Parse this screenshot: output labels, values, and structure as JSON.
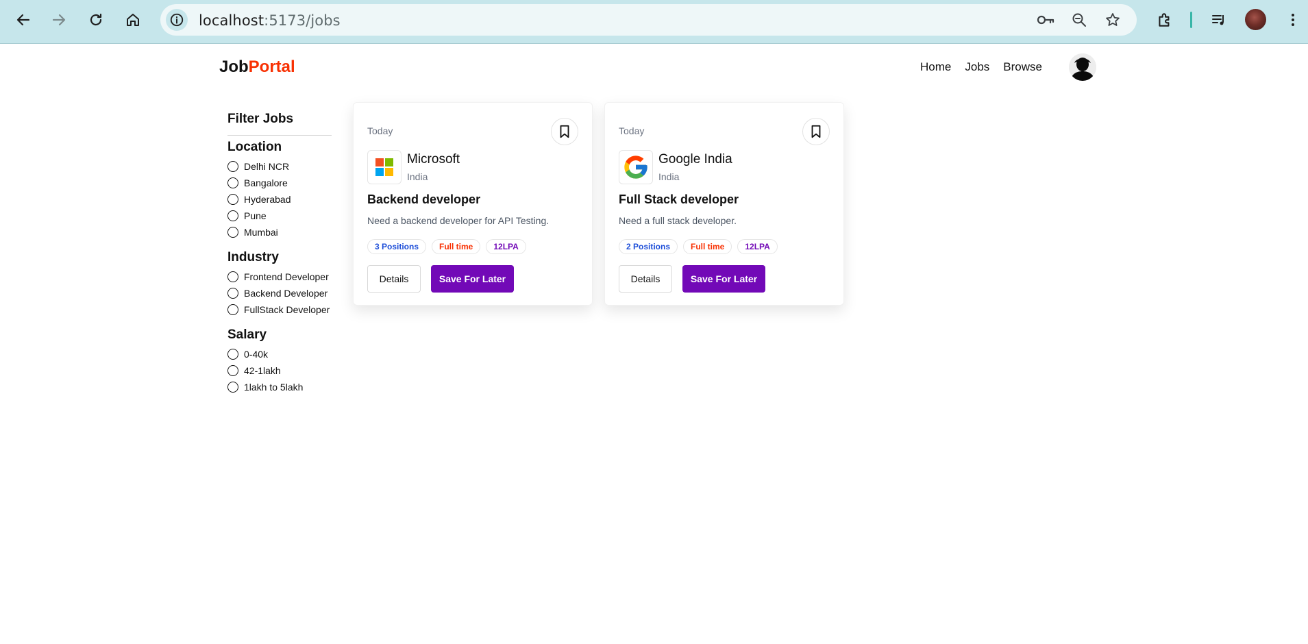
{
  "browser": {
    "url_host": "localhost",
    "url_path": ":5173/jobs",
    "icons": [
      "back-icon",
      "forward-icon",
      "reload-icon",
      "home-icon",
      "site-info-icon",
      "password-key-icon",
      "zoom-icon",
      "star-icon",
      "extensions-icon",
      "media-queue-icon",
      "profile-avatar",
      "menu-icon"
    ]
  },
  "header": {
    "logo_primary": "Job",
    "logo_accent": "Portal",
    "logo_accent_color": "#f83002",
    "nav": [
      {
        "label": "Home"
      },
      {
        "label": "Jobs"
      },
      {
        "label": "Browse"
      }
    ]
  },
  "filters": {
    "title": "Filter Jobs",
    "groups": [
      {
        "title": "Location",
        "options": [
          "Delhi NCR",
          "Bangalore",
          "Hyderabad",
          "Pune",
          "Mumbai"
        ]
      },
      {
        "title": "Industry",
        "options": [
          "Frontend Developer",
          "Backend Developer",
          "FullStack Developer"
        ]
      },
      {
        "title": "Salary",
        "options": [
          "0-40k",
          "42-1lakh",
          "1lakh to 5lakh"
        ]
      }
    ]
  },
  "jobs": [
    {
      "posted": "Today",
      "company": "Microsoft",
      "location": "India",
      "title": "Backend developer",
      "description": "Need a backend developer for API Testing.",
      "positions": "3 Positions",
      "type": "Full time",
      "salary": "12LPA",
      "details_label": "Details",
      "save_label": "Save For Later",
      "logo_icon": "microsoft-logo-icon"
    },
    {
      "posted": "Today",
      "company": "Google India",
      "location": "India",
      "title": "Full Stack developer",
      "description": "Need a full stack developer.",
      "positions": "2 Positions",
      "type": "Full time",
      "salary": "12LPA",
      "details_label": "Details",
      "save_label": "Save For Later",
      "logo_icon": "google-logo-icon"
    }
  ],
  "colors": {
    "primary_button": "#7209b7",
    "accent": "#f83002",
    "badge_blue": "#1d4ed8",
    "chrome_bg": "#c6e6eb"
  }
}
